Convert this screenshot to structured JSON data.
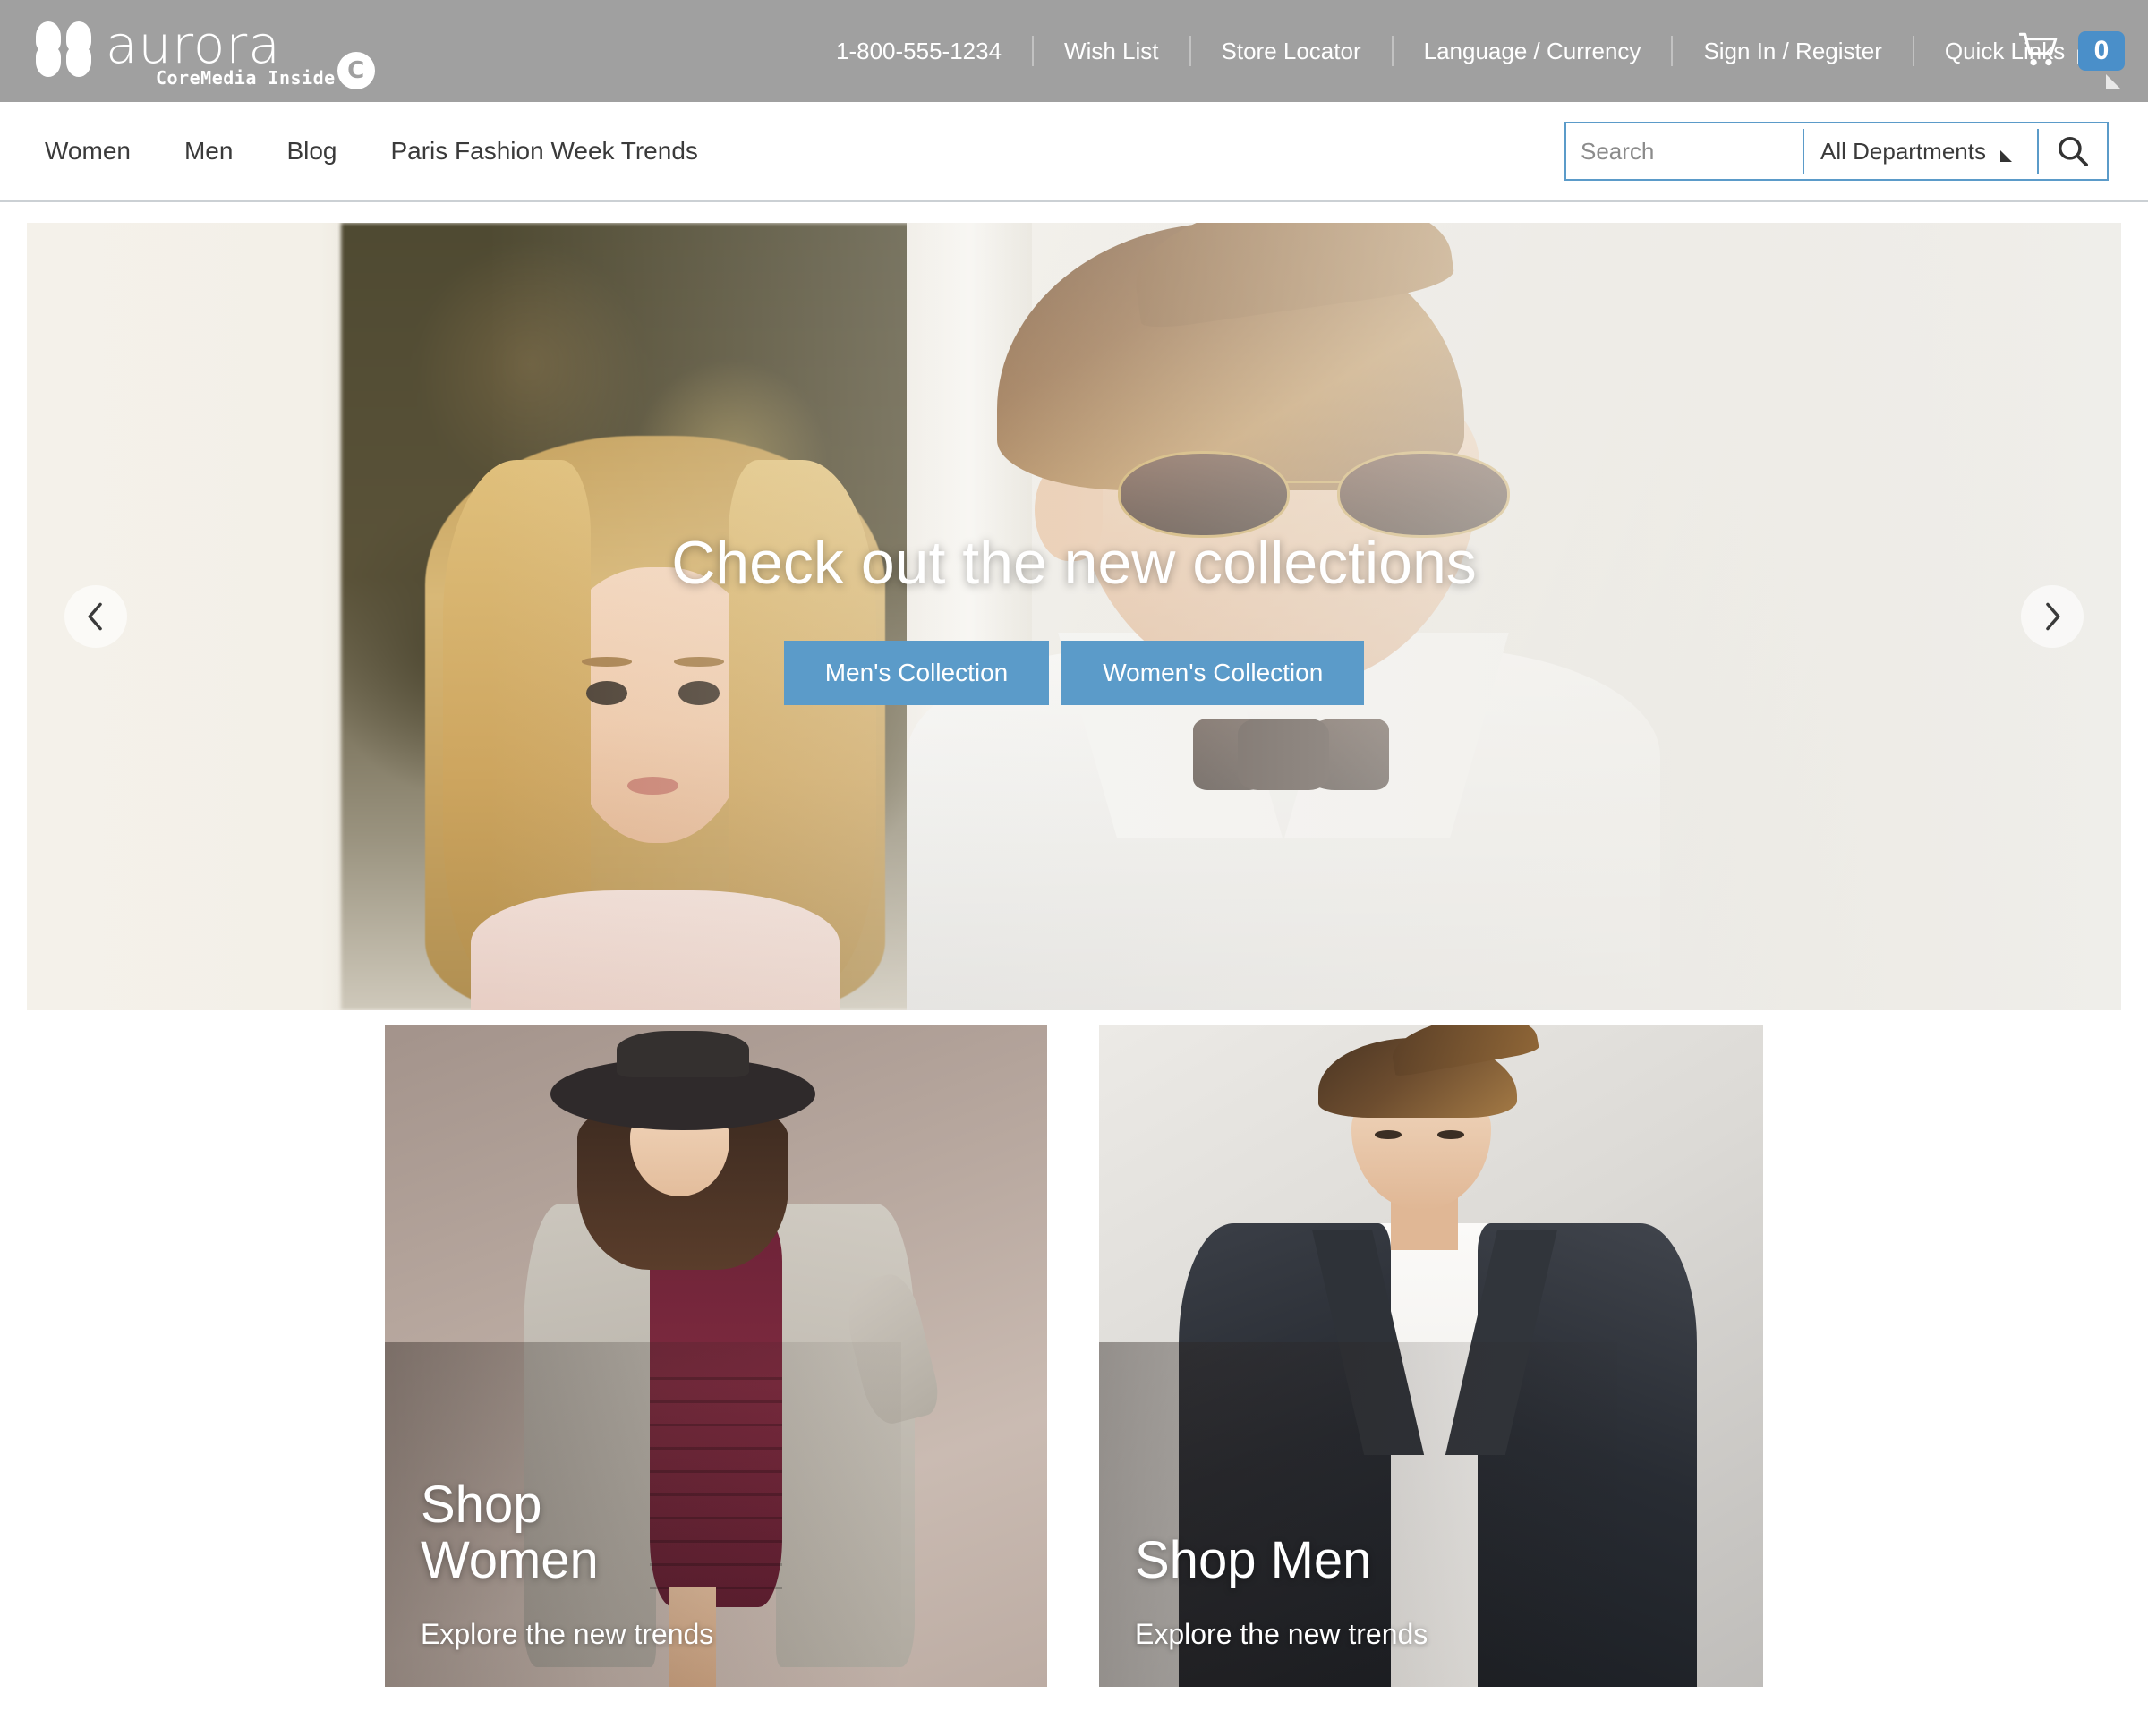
{
  "brand": {
    "name": "aurora",
    "tagline": "CoreMedia Inside",
    "badge_letter": "C",
    "accent_blue": "#5b9bc9",
    "topbar_gray": "#a0a0a0"
  },
  "topbar": {
    "links": [
      {
        "label": "1-800-555-1234",
        "name": "phone-link"
      },
      {
        "label": "Wish List",
        "name": "wish-list-link"
      },
      {
        "label": "Store Locator",
        "name": "store-locator-link"
      },
      {
        "label": "Language / Currency",
        "name": "language-currency-link"
      },
      {
        "label": "Sign In / Register",
        "name": "sign-in-register-link"
      },
      {
        "label": "Quick Links",
        "name": "quick-links-link",
        "has_caret": true
      }
    ],
    "cart": {
      "count": "0"
    }
  },
  "mainnav": {
    "items": [
      {
        "label": "Women"
      },
      {
        "label": "Men"
      },
      {
        "label": "Blog"
      },
      {
        "label": "Paris Fashion Week Trends"
      }
    ]
  },
  "search": {
    "value": "",
    "placeholder": "Search",
    "department_selected": "All Departments",
    "department_options": [
      "All Departments"
    ]
  },
  "hero": {
    "title": "Check out the new collections",
    "buttons": [
      {
        "label": "Men's Collection"
      },
      {
        "label": "Women's Collection"
      }
    ],
    "prev_label": "‹",
    "next_label": "›"
  },
  "cards": [
    {
      "title": "Shop\nWomen",
      "subtitle": "Explore the new trends"
    },
    {
      "title": "Shop Men",
      "subtitle": "Explore the new trends"
    }
  ]
}
